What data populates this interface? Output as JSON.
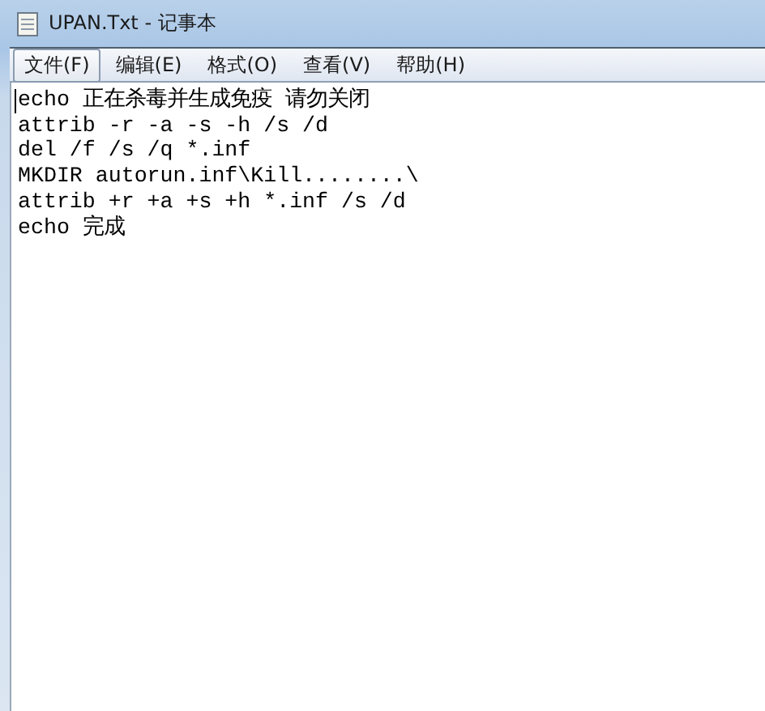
{
  "window": {
    "title": "UPAN.Txt - 记事本"
  },
  "menu": [
    {
      "label": "文件(F)",
      "selected": true
    },
    {
      "label": "编辑(E)",
      "selected": false
    },
    {
      "label": "格式(O)",
      "selected": false
    },
    {
      "label": "查看(V)",
      "selected": false
    },
    {
      "label": "帮助(H)",
      "selected": false
    }
  ],
  "editor": {
    "lines": [
      "echo 正在杀毒并生成免疫 请勿关闭",
      "attrib -r -a -s -h /s /d",
      "del /f /s /q *.inf",
      "MKDIR autorun.inf\\Kill........\\",
      "attrib +r +a +s +h *.inf /s /d",
      "echo 完成"
    ]
  }
}
